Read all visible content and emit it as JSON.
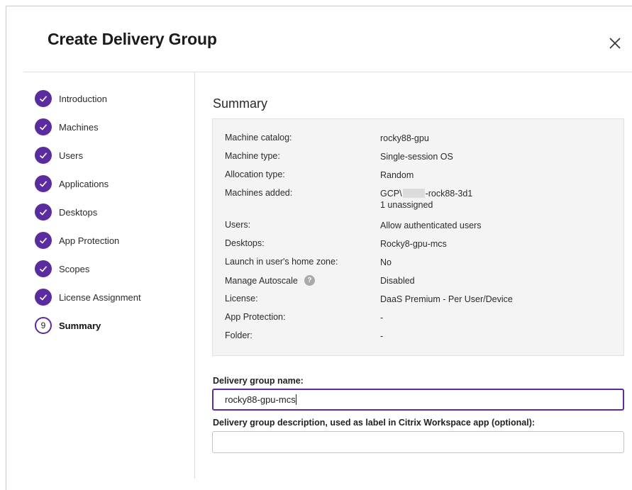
{
  "dialog": {
    "title": "Create Delivery Group"
  },
  "steps": [
    {
      "label": "Introduction",
      "state": "done"
    },
    {
      "label": "Machines",
      "state": "done"
    },
    {
      "label": "Users",
      "state": "done"
    },
    {
      "label": "Applications",
      "state": "done"
    },
    {
      "label": "Desktops",
      "state": "done"
    },
    {
      "label": "App Protection",
      "state": "done"
    },
    {
      "label": "Scopes",
      "state": "done"
    },
    {
      "label": "License Assignment",
      "state": "done"
    },
    {
      "label": "Summary",
      "state": "current",
      "number": "9"
    }
  ],
  "summary": {
    "title": "Summary",
    "rows": [
      {
        "key": "Machine catalog:",
        "value": "rocky88-gpu"
      },
      {
        "key": "Machine type:",
        "value": "Single-session OS"
      },
      {
        "key": "Allocation type:",
        "value": "Random"
      },
      {
        "key": "Machines added:",
        "value_prefix": "GCP\\",
        "value_suffix": "-rock88-3d1",
        "value_line2": "1 unassigned"
      },
      {
        "key": "Users:",
        "value": "Allow authenticated users"
      },
      {
        "key": "Desktops:",
        "value": "Rocky8-gpu-mcs"
      },
      {
        "key": "Launch in user's home zone:",
        "value": "No"
      },
      {
        "key": "Manage Autoscale",
        "value": "Disabled",
        "help": "?"
      },
      {
        "key": "License:",
        "value": "DaaS Premium - Per User/Device"
      },
      {
        "key": "App Protection:",
        "value": "-"
      },
      {
        "key": "Folder:",
        "value": "-"
      }
    ]
  },
  "form": {
    "name_label": "Delivery group name:",
    "name_value": "rocky88-gpu-mcs",
    "description_label": "Delivery group description, used as label in Citrix Workspace app (optional):",
    "description_value": ""
  },
  "colors": {
    "accent": "#5a2ca0",
    "summary_bg": "#f4f4f4"
  },
  "icons": {
    "close": "close-icon",
    "step_done": "checkmark-icon",
    "help": "help-icon"
  }
}
